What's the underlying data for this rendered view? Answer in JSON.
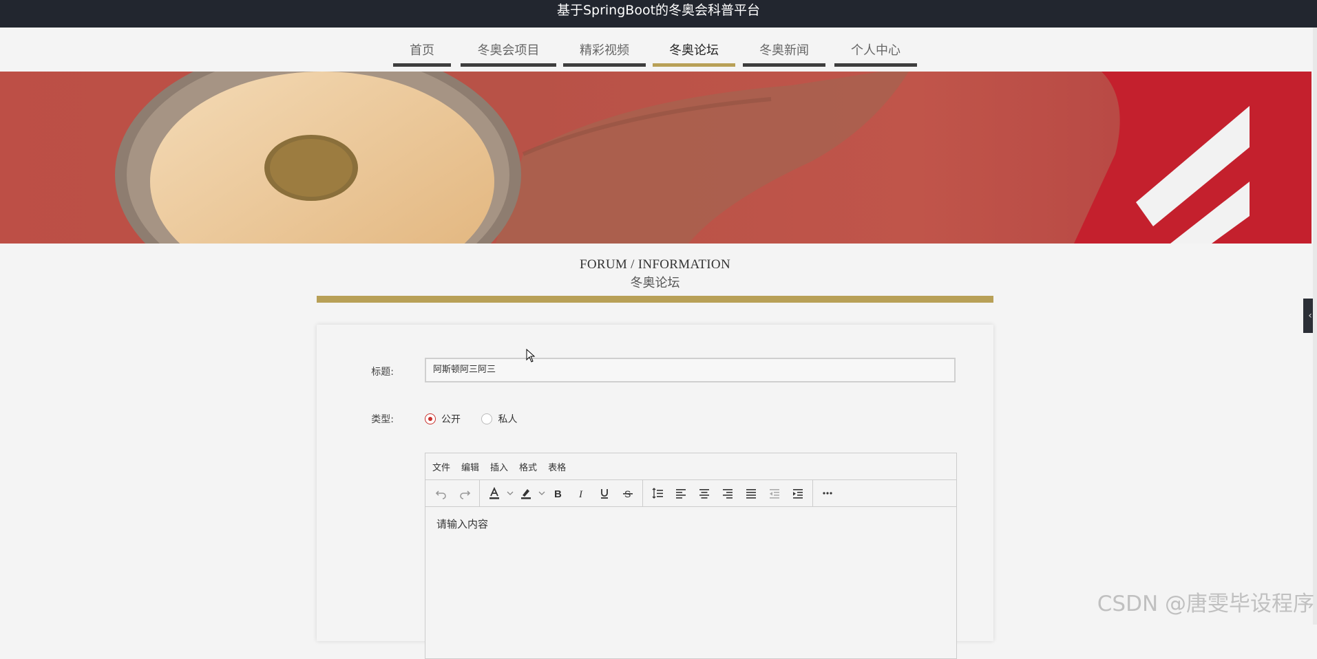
{
  "app": {
    "title": "基于SpringBoot的冬奥会科普平台"
  },
  "nav": {
    "items": [
      {
        "label": "首页"
      },
      {
        "label": "冬奥会项目"
      },
      {
        "label": "精彩视频"
      },
      {
        "label": "冬奥论坛"
      },
      {
        "label": "冬奥新闻"
      },
      {
        "label": "个人中心"
      }
    ],
    "active": "冬奥论坛"
  },
  "section": {
    "title_en": "FORUM / INFORMATION",
    "title_zh": "冬奥论坛"
  },
  "form": {
    "title_label": "标题:",
    "title_value": "阿斯顿阿三阿三",
    "type_label": "类型:",
    "type_options": [
      {
        "label": "公开",
        "checked": true
      },
      {
        "label": "私人",
        "checked": false
      }
    ],
    "editor": {
      "menu": [
        "文件",
        "编辑",
        "插入",
        "格式",
        "表格"
      ],
      "placeholder": "请输入内容"
    }
  },
  "colors": {
    "accent": "#b8a057",
    "topbar": "#22262f",
    "radio_checked": "#c9302c"
  },
  "watermark": "CSDN @唐雯毕设程序"
}
